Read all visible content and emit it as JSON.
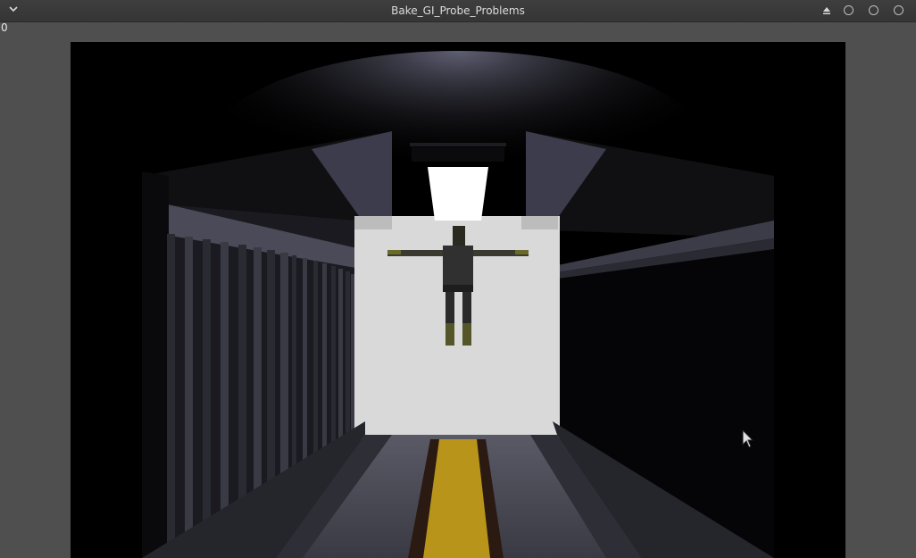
{
  "window": {
    "title": "Bake_GI_Probe_Problems",
    "menu_icon": "chevron-down-icon",
    "controls": [
      "eject-icon",
      "circle-button-icon",
      "circle-button-icon",
      "circle-button-icon"
    ]
  },
  "hud": {
    "frame_counter": "0"
  },
  "scene": {
    "description_icons": [
      "ceiling-light-icon",
      "character-icon",
      "corridor-icon",
      "mouse-cursor-icon"
    ],
    "colors": {
      "floor_stripe": "#b8951a",
      "back_wall": "#d9d9d9",
      "light": "#ffffff"
    }
  }
}
